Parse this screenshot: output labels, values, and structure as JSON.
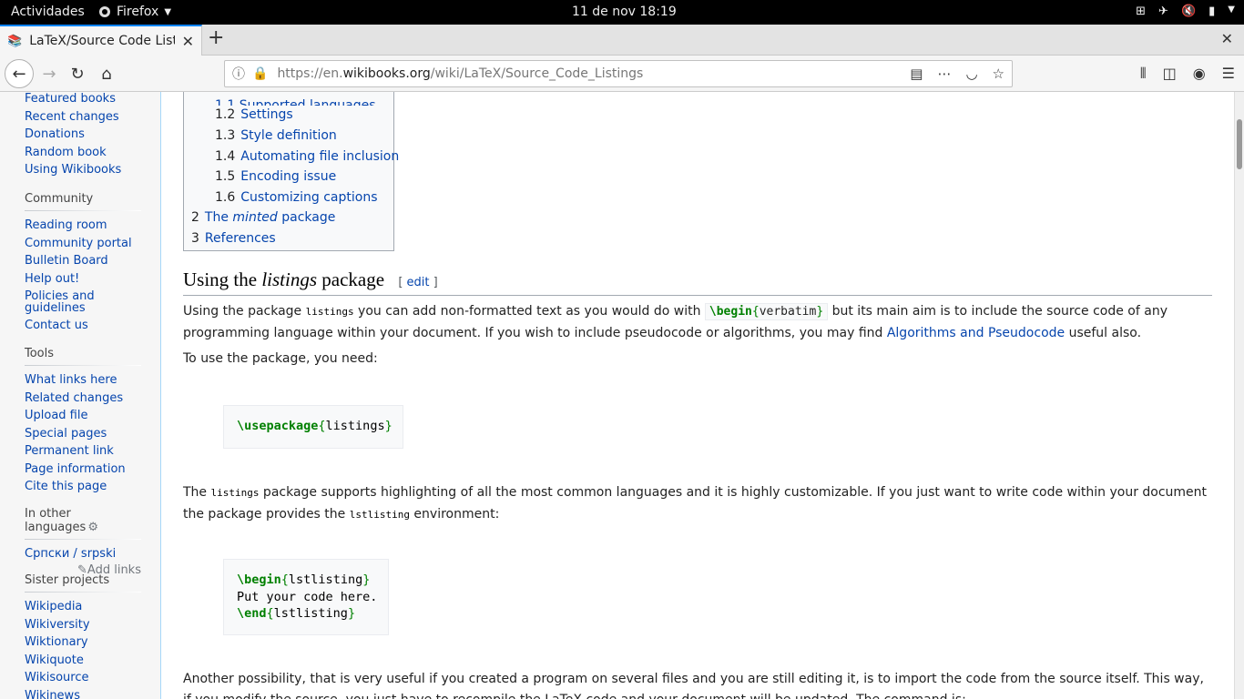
{
  "system_bar": {
    "activities": "Actividades",
    "app_name": "Firefox",
    "clock": "11 de nov  18:19"
  },
  "browser": {
    "tab_title": "LaTeX/Source Code Listin",
    "url_prefix": "https://en.",
    "url_domain": "wikibooks.org",
    "url_path": "/wiki/LaTeX/Source_Code_Listings"
  },
  "sidebar": {
    "navigation": [
      "Featured books",
      "Recent changes",
      "Donations",
      "Random book",
      "Using Wikibooks"
    ],
    "community_heading": "Community",
    "community": [
      "Reading room",
      "Community portal",
      "Bulletin Board",
      "Help out!",
      "Policies and guidelines",
      "Contact us"
    ],
    "tools_heading": "Tools",
    "tools": [
      "What links here",
      "Related changes",
      "Upload file",
      "Special pages",
      "Permanent link",
      "Page information",
      "Cite this page"
    ],
    "languages_heading": "In other languages",
    "languages": [
      "Српски / srpski"
    ],
    "add_links": "Add links",
    "sister_heading": "Sister projects",
    "sister": [
      "Wikipedia",
      "Wikiversity",
      "Wiktionary",
      "Wikiquote",
      "Wikisource",
      "Wikinews"
    ]
  },
  "toc": [
    {
      "num": "1.2",
      "text": "Settings"
    },
    {
      "num": "1.3",
      "text": "Style definition"
    },
    {
      "num": "1.4",
      "text": "Automating file inclusion"
    },
    {
      "num": "1.5",
      "text": "Encoding issue"
    },
    {
      "num": "1.6",
      "text": "Customizing captions"
    },
    {
      "num": "2",
      "text_pre": "The ",
      "text_em": "minted",
      "text_post": " package"
    },
    {
      "num": "3",
      "text": "References"
    }
  ],
  "section": {
    "heading_pre": "Using the ",
    "heading_em": "listings",
    "heading_post": " package",
    "edit_open": "[ ",
    "edit_label": "edit",
    "edit_close": " ]"
  },
  "p1": {
    "a": "Using the package ",
    "code": "listings",
    "b": " you can add non-formatted text as you would do with ",
    "vb_cmd": "\\begin",
    "vb_open": "{",
    "vb_arg": "verbatim",
    "vb_close": "}",
    "c": " but its main aim is to include the source code of any programming language within your document. If you wish to include pseudocode or algorithms, you may find ",
    "link": "Algorithms and Pseudocode",
    "d": " useful also."
  },
  "p2": "To use the package, you need:",
  "code1": {
    "cmd": "\\usepackage",
    "open": "{",
    "arg": "listings",
    "close": "}"
  },
  "p3": {
    "a": "The ",
    "code": "listings",
    "b": " package supports highlighting of all the most common languages and it is highly customizable. If you just want to write code within your document the package provides the ",
    "code2": "lstlisting",
    "c": " environment:"
  },
  "code2": {
    "l1_cmd": "\\begin",
    "l1_open": "{",
    "l1_arg": "lstlisting",
    "l1_close": "}",
    "l2": "Put your code here.",
    "l3_cmd": "\\end",
    "l3_open": "{",
    "l3_arg": "lstlisting",
    "l3_close": "}"
  },
  "p4": "Another possibility, that is very useful if you created a program on several files and you are still editing it, is to import the code from the source itself. This way, if you modify the source, you just have to recompile the LaTeX code and your document will be updated. The command is:"
}
